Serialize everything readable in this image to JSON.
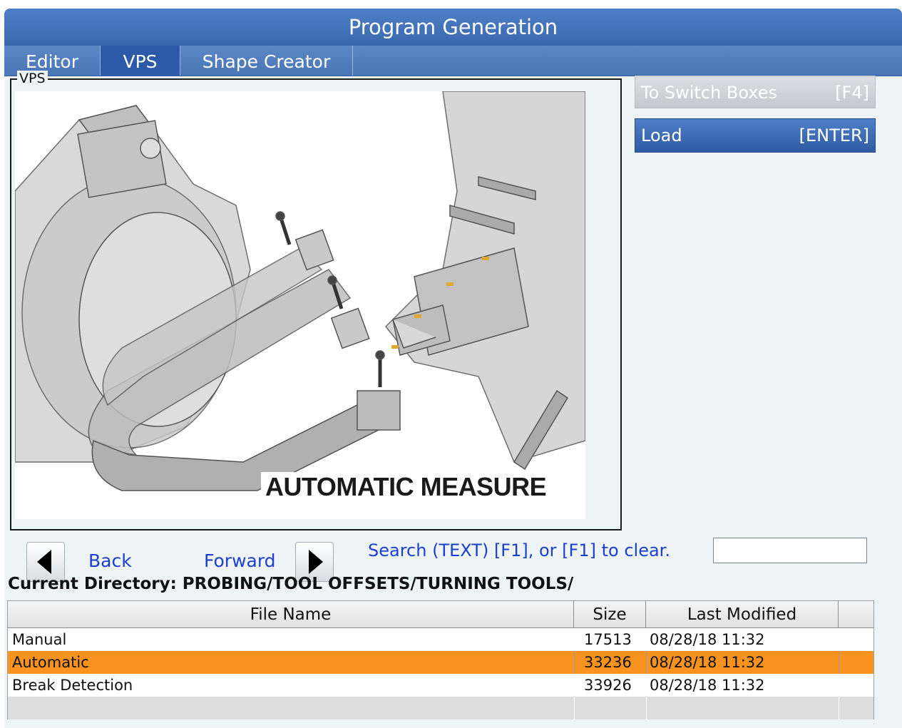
{
  "window": {
    "title": "Program Generation"
  },
  "tabs": [
    {
      "label": "Editor",
      "active": false
    },
    {
      "label": "VPS",
      "active": true
    },
    {
      "label": "Shape Creator",
      "active": false
    }
  ],
  "vps_panel": {
    "legend": "VPS",
    "illustration": {
      "caption": "AUTOMATIC MEASURE"
    }
  },
  "actions": {
    "switch_boxes": {
      "label": "To Switch Boxes",
      "key": "[F4]"
    },
    "load": {
      "label": "Load",
      "key": "[ENTER]"
    }
  },
  "nav": {
    "back_label": "Back",
    "forward_label": "Forward",
    "search_hint": "Search (TEXT) [F1], or [F1] to clear.",
    "search_value": ""
  },
  "current_directory": "Current Directory: PROBING/TOOL OFFSETS/TURNING TOOLS/",
  "file_table": {
    "columns": [
      "File Name",
      "Size",
      "Last Modified"
    ],
    "rows": [
      {
        "name": "Manual",
        "size": "17513",
        "modified": "08/28/18 11:32",
        "selected": false
      },
      {
        "name": "Automatic",
        "size": "33236",
        "modified": "08/28/18 11:32",
        "selected": true
      },
      {
        "name": "Break Detection",
        "size": "33926",
        "modified": "08/28/18 11:32",
        "selected": false
      }
    ]
  },
  "colors": {
    "title_blue": "#4e7fc4",
    "active_tab": "#2d5aa8",
    "link_blue": "#1b3fd0",
    "selection_orange": "#f7931e",
    "panel_bg": "#eef3f6"
  },
  "icons": [
    "triangle-left-icon",
    "triangle-right-icon"
  ]
}
